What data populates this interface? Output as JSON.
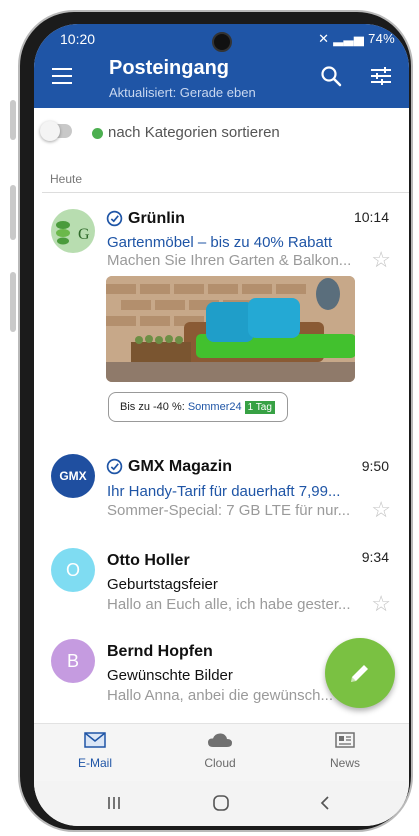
{
  "status": {
    "time": "10:20",
    "battery": "74%"
  },
  "header": {
    "title": "Posteingang",
    "subtitle": "Aktualisiert: Gerade eben"
  },
  "filter": {
    "label": "nach Kategorien sortieren"
  },
  "section": "Heute",
  "emails": [
    {
      "sender": "Grünlin",
      "time": "10:14",
      "subject": "Gartenmöbel – bis zu 40% Rabatt",
      "preview": "Machen Sie Ihren Garten & Balkon..."
    },
    {
      "sender": "GMX Magazin",
      "time": "9:50",
      "subject": "Ihr Handy-Tarif für dauerhaft 7,99...",
      "preview": "Sommer-Special: 7 GB LTE für nur..."
    },
    {
      "sender": "Otto Holler",
      "time": "9:34",
      "subject": "Geburtstagsfeier",
      "preview": "Hallo an Euch alle, ich habe gester..."
    },
    {
      "sender": "Bernd Hopfen",
      "subject": "Gewünschte Bilder",
      "preview": "Hallo Anna, anbei die gewünsch..."
    }
  ],
  "promo": {
    "text": "Bis zu -40 %:",
    "code": "Sommer24",
    "badge": "1 Tag"
  },
  "avatars": {
    "grunlin": "G",
    "gmx": "GMX",
    "otto": "O",
    "bernd": "B"
  },
  "nav": {
    "email": "E-Mail",
    "cloud": "Cloud",
    "news": "News"
  },
  "colors": {
    "header": "#1f55a6",
    "fab": "#7ac142",
    "link": "#1f55a6",
    "otto_avatar": "#7fdcf2",
    "bernd_avatar": "#c59be0"
  }
}
